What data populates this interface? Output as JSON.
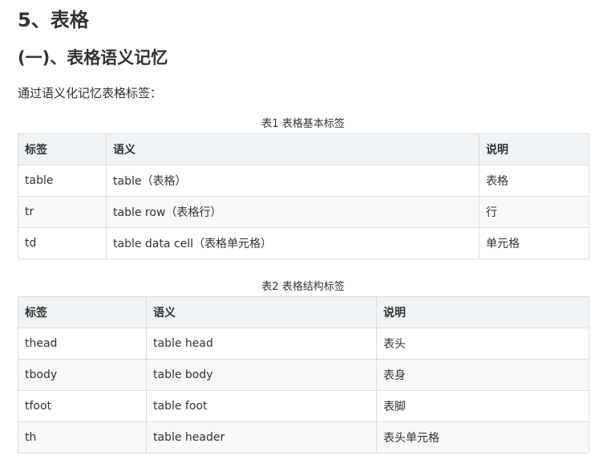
{
  "heading": "5、表格",
  "subheading": "(一)、表格语义记忆",
  "intro": "通过语义化记忆表格标签：",
  "table1": {
    "caption": "表1 表格基本标签",
    "headers": [
      "标签",
      "语义",
      "说明"
    ],
    "rows": [
      [
        "table",
        "table（表格）",
        "表格"
      ],
      [
        "tr",
        "table row（表格行）",
        "行"
      ],
      [
        "td",
        "table data cell（表格单元格）",
        "单元格"
      ]
    ]
  },
  "table2": {
    "caption": "表2 表格结构标签",
    "headers": [
      "标签",
      "语义",
      "说明"
    ],
    "rows": [
      [
        "thead",
        "table head",
        "表头"
      ],
      [
        "tbody",
        "table body",
        "表身"
      ],
      [
        "tfoot",
        "table foot",
        "表脚"
      ],
      [
        "th",
        "table header",
        "表头单元格"
      ]
    ]
  }
}
